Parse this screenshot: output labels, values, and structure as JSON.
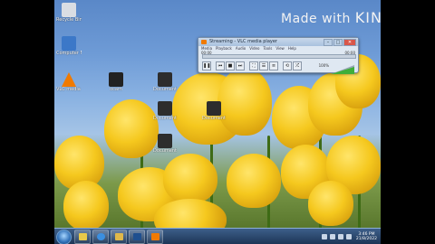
{
  "watermark": {
    "prefix": "Made with",
    "brand": "KINEMASTER"
  },
  "desktop_icons": [
    {
      "label": "Recycle Bin",
      "color": "#d9dde3"
    },
    {
      "label": "Computer Network",
      "color": "#3c78c8"
    },
    {
      "label": "VLC media player",
      "color": "#f07a00"
    },
    {
      "label": "ocam",
      "color": "#222222"
    },
    {
      "label": "Document",
      "color": "#2d2d2d"
    },
    {
      "label": "Document",
      "color": "#2d2d2d"
    },
    {
      "label": "Document",
      "color": "#2d2d2d"
    },
    {
      "label": "Document",
      "color": "#2d2d2d"
    },
    {
      "label": "Document",
      "color": "#2d2d2d"
    }
  ],
  "player": {
    "title": "Streaming - VLC media player",
    "menu": [
      "Media",
      "Playback",
      "Audio",
      "Video",
      "Tools",
      "View",
      "Help"
    ],
    "elapsed": "00:00",
    "remaining": "00:00",
    "volume_label": "100%",
    "progress": 0,
    "volume": 1.0,
    "accent": "#f07a00"
  },
  "taskbar": {
    "buttons": [
      {
        "name": "explorer",
        "color": "#e9c94a"
      },
      {
        "name": "ie",
        "color": "#3b8fe0"
      },
      {
        "name": "folder",
        "color": "#e0b84a"
      },
      {
        "name": "photoshop",
        "color": "#1f4f8f"
      },
      {
        "name": "vlc",
        "color": "#f07a00"
      }
    ],
    "time": "3:46 PM",
    "date": "21/8/2022"
  }
}
